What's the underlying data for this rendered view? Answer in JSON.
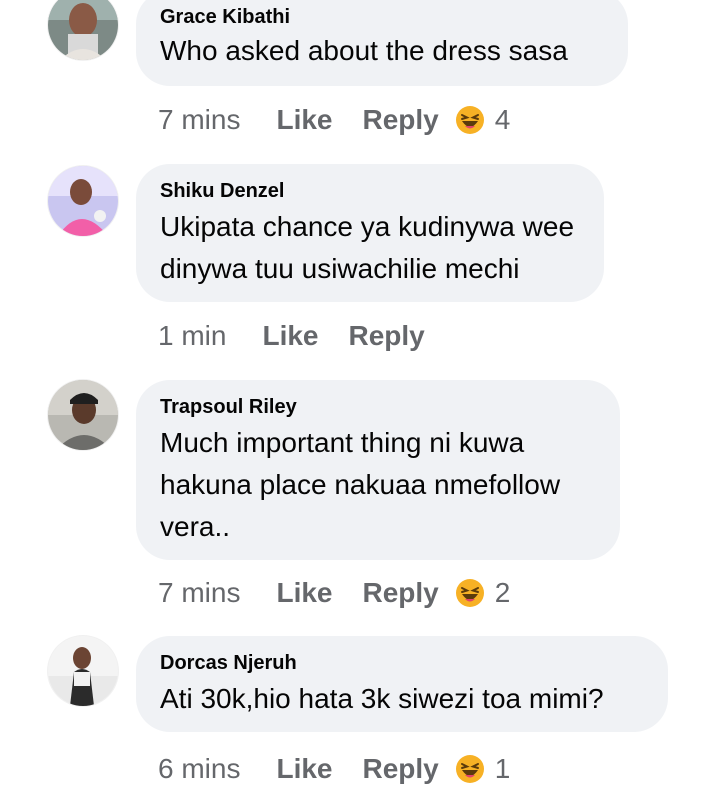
{
  "comments": [
    {
      "author": "Grace Kibathi",
      "lines": [
        "Who asked about the dress sasa"
      ],
      "time": "7 mins",
      "like_label": "Like",
      "reply_label": "Reply",
      "reaction_icon": "haha-emoji-icon",
      "reaction_count": "4"
    },
    {
      "author": "Shiku Denzel",
      "lines": [
        "Ukipata chance ya kudinywa wee",
        "dinywa tuu usiwachilie mechi"
      ],
      "time": "1 min",
      "like_label": "Like",
      "reply_label": "Reply"
    },
    {
      "author": "Trapsoul Riley",
      "lines": [
        "Much important thing ni kuwa",
        "hakuna place nakuaa nmefollow",
        "vera.."
      ],
      "time": "7 mins",
      "like_label": "Like",
      "reply_label": "Reply",
      "reaction_icon": "haha-emoji-icon",
      "reaction_count": "2"
    },
    {
      "author": "Dorcas Njeruh",
      "lines": [
        "Ati 30k,hio hata 3k siwezi toa mimi?"
      ],
      "time": "6 mins",
      "like_label": "Like",
      "reply_label": "Reply",
      "reaction_icon": "haha-emoji-icon",
      "reaction_count": "1"
    }
  ],
  "colors": {
    "bubble_bg": "#f0f2f5",
    "meta_text": "#65676b",
    "name_text": "#050505",
    "haha_face": "#f7b125"
  }
}
